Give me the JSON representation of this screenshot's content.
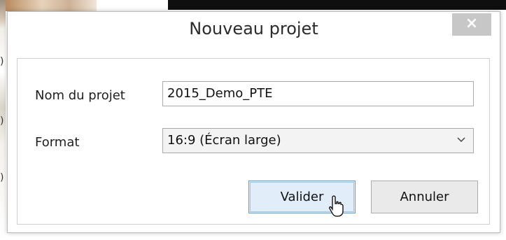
{
  "dialog": {
    "title": "Nouveau projet",
    "close_label": "×"
  },
  "form": {
    "name_label": "Nom du projet",
    "name_value": "2015_Demo_PTE",
    "format_label": "Format",
    "format_value": "16:9 (Écran large)"
  },
  "buttons": {
    "validate": "Valider",
    "cancel": "Annuler"
  },
  "background": {
    "marks": [
      ")",
      ")",
      ")"
    ]
  },
  "colors": {
    "primary_button_border": "#5a9fd8",
    "primary_button_bg": "#e1edf9",
    "close_button_bg": "#c7c7c7"
  }
}
